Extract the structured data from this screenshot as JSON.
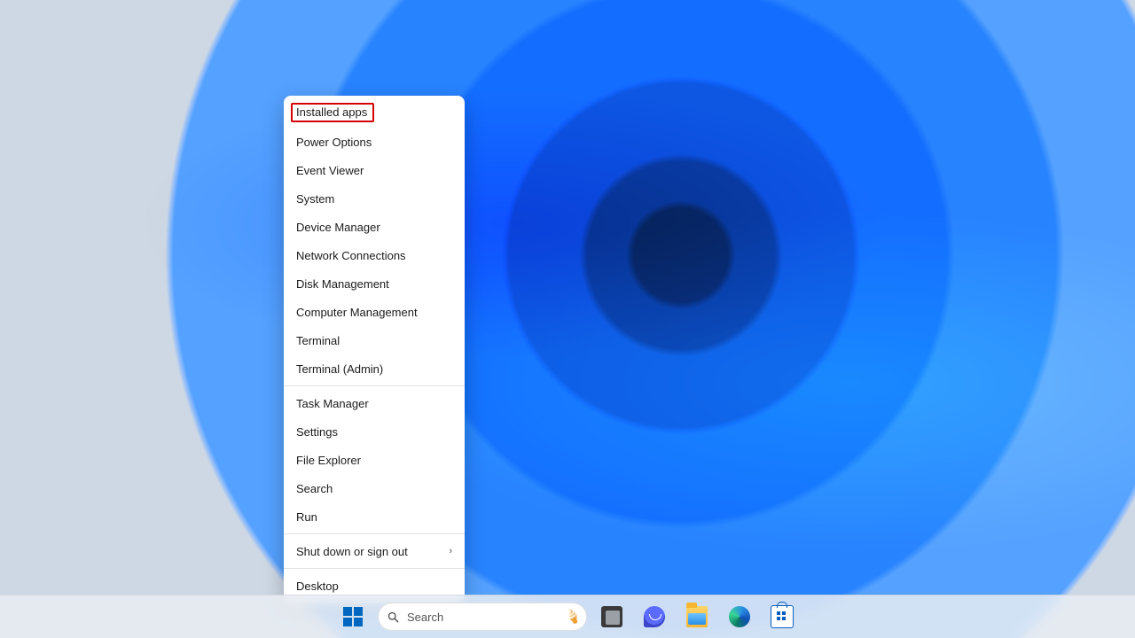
{
  "winx_menu": {
    "highlighted_index": 0,
    "groups": [
      [
        "Installed apps",
        "Power Options",
        "Event Viewer",
        "System",
        "Device Manager",
        "Network Connections",
        "Disk Management",
        "Computer Management",
        "Terminal",
        "Terminal (Admin)"
      ],
      [
        "Task Manager",
        "Settings",
        "File Explorer",
        "Search",
        "Run"
      ],
      [
        "Shut down or sign out"
      ],
      [
        "Desktop"
      ]
    ],
    "submenu_flags": {
      "Shut down or sign out": true
    }
  },
  "taskbar": {
    "search_placeholder": "Search"
  }
}
